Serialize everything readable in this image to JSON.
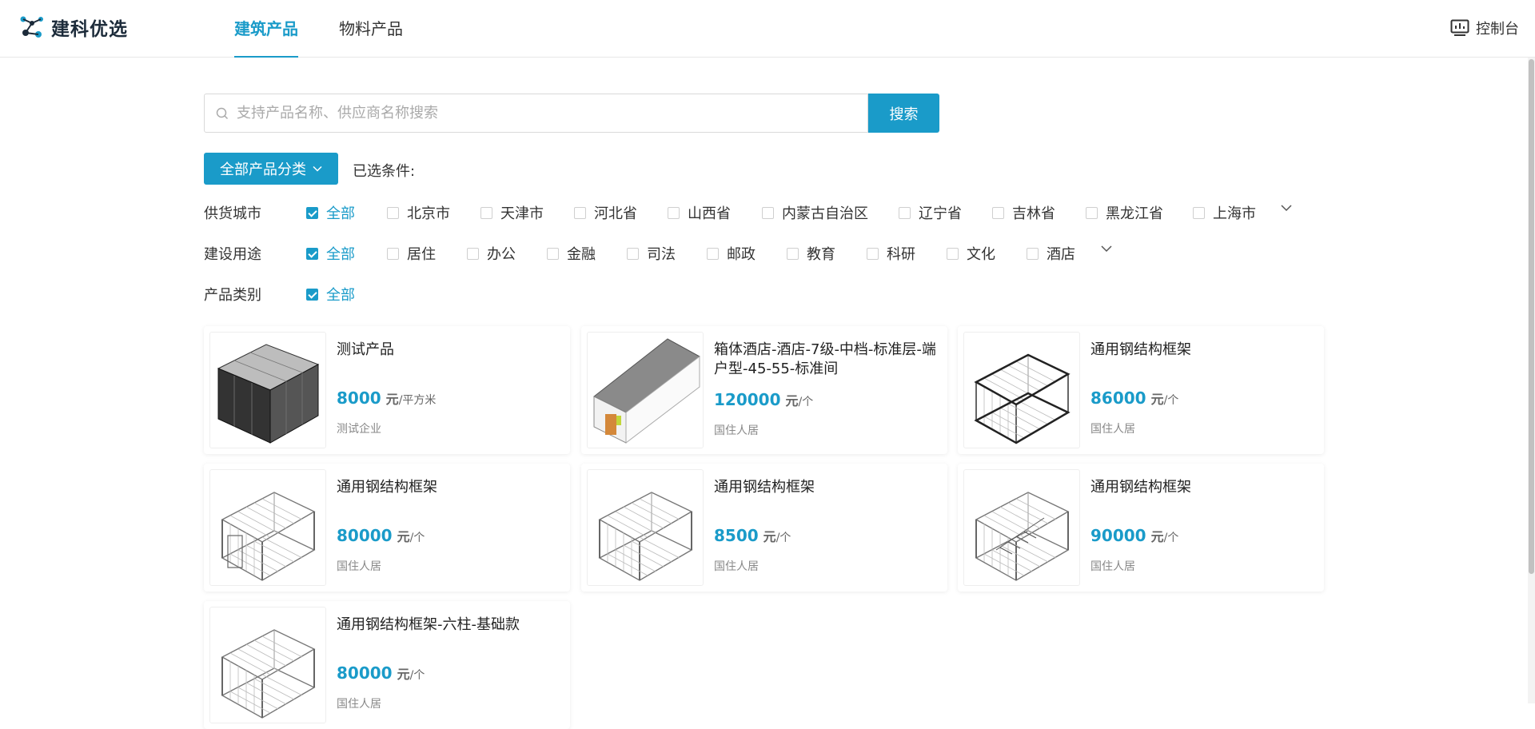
{
  "header": {
    "logo_text": "建科优选",
    "tabs": [
      {
        "label": "建筑产品",
        "active": true
      },
      {
        "label": "物料产品",
        "active": false
      }
    ],
    "console_label": "控制台"
  },
  "search": {
    "placeholder": "支持产品名称、供应商名称搜索",
    "value": "",
    "button_label": "搜索"
  },
  "category_button": "全部产品分类",
  "selected_conditions_label": "已选条件:",
  "filters": {
    "city": {
      "label": "供货城市",
      "options": [
        {
          "label": "全部",
          "checked": true
        },
        {
          "label": "北京市",
          "checked": false
        },
        {
          "label": "天津市",
          "checked": false
        },
        {
          "label": "河北省",
          "checked": false
        },
        {
          "label": "山西省",
          "checked": false
        },
        {
          "label": "内蒙古自治区",
          "checked": false
        },
        {
          "label": "辽宁省",
          "checked": false
        },
        {
          "label": "吉林省",
          "checked": false
        },
        {
          "label": "黑龙江省",
          "checked": false
        },
        {
          "label": "上海市",
          "checked": false
        }
      ]
    },
    "usage": {
      "label": "建设用途",
      "options": [
        {
          "label": "全部",
          "checked": true
        },
        {
          "label": "居住",
          "checked": false
        },
        {
          "label": "办公",
          "checked": false
        },
        {
          "label": "金融",
          "checked": false
        },
        {
          "label": "司法",
          "checked": false
        },
        {
          "label": "邮政",
          "checked": false
        },
        {
          "label": "教育",
          "checked": false
        },
        {
          "label": "科研",
          "checked": false
        },
        {
          "label": "文化",
          "checked": false
        },
        {
          "label": "酒店",
          "checked": false
        }
      ]
    },
    "category": {
      "label": "产品类别",
      "options": [
        {
          "label": "全部",
          "checked": true
        }
      ]
    }
  },
  "products": [
    {
      "title": "测试产品",
      "price": "8000",
      "unit": "元",
      "unit_sub": "/平方米",
      "supplier": "测试企业",
      "thumb": "dark-module-icon"
    },
    {
      "title": "箱体酒店-酒店-7级-中档-标准层-端户型-45-55-标准间",
      "price": "120000",
      "unit": "元",
      "unit_sub": "/个",
      "supplier": "国住人居",
      "thumb": "container-room-icon"
    },
    {
      "title": "通用钢结构框架",
      "price": "86000",
      "unit": "元",
      "unit_sub": "/个",
      "supplier": "国住人居",
      "thumb": "steel-frame-icon"
    },
    {
      "title": "通用钢结构框架",
      "price": "80000",
      "unit": "元",
      "unit_sub": "/个",
      "supplier": "国住人居",
      "thumb": "steel-frame-icon"
    },
    {
      "title": "通用钢结构框架",
      "price": "8500",
      "unit": "元",
      "unit_sub": "/个",
      "supplier": "国住人居",
      "thumb": "steel-frame-icon"
    },
    {
      "title": "通用钢结构框架",
      "price": "90000",
      "unit": "元",
      "unit_sub": "/个",
      "supplier": "国住人居",
      "thumb": "stair-frame-icon"
    },
    {
      "title": "通用钢结构框架-六柱-基础款",
      "price": "80000",
      "unit": "元",
      "unit_sub": "/个",
      "supplier": "国住人居",
      "thumb": "steel-frame-icon"
    }
  ],
  "colors": {
    "accent": "#1a9bc9"
  }
}
